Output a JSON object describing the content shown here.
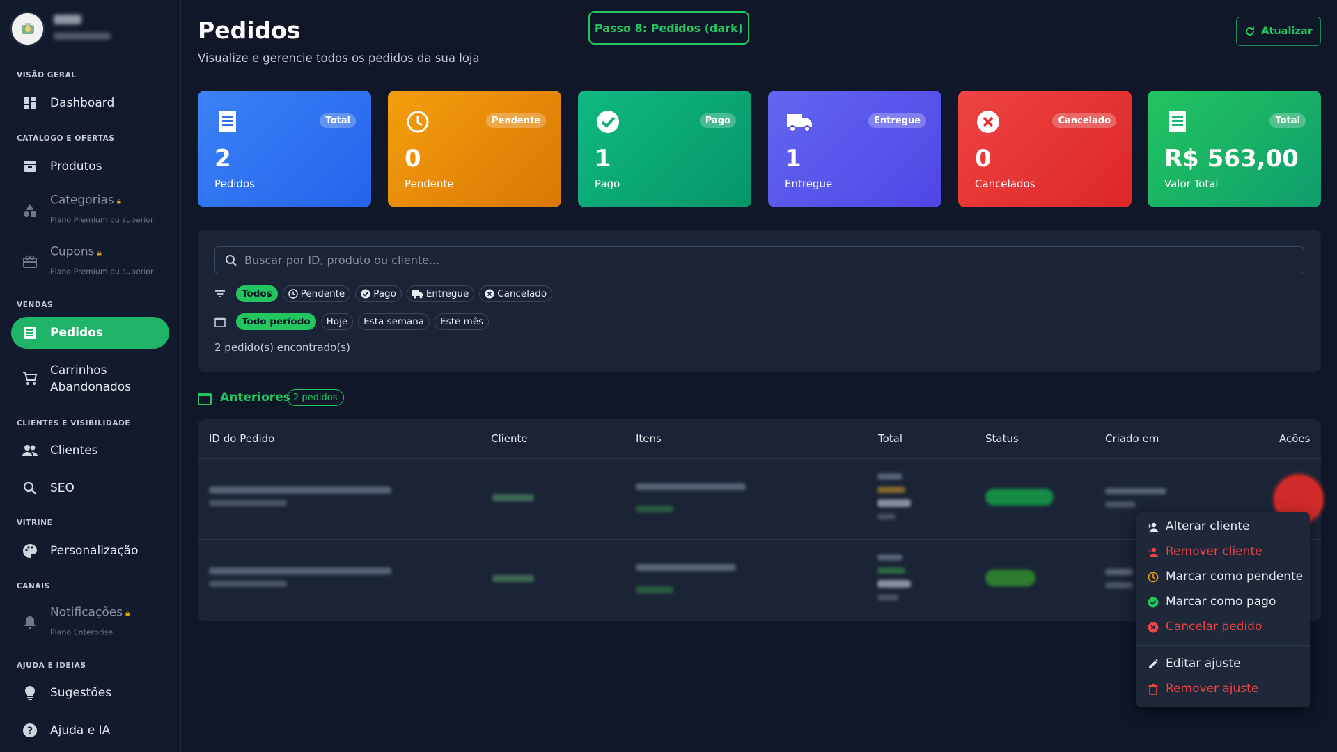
{
  "sidebar": {
    "sections": {
      "overview": "VISÃO GERAL",
      "catalog": "CATÁLOGO E OFERTAS",
      "sales": "VENDAS",
      "clients": "CLIENTES E VISIBILIDADE",
      "showcase": "VITRINE",
      "channels": "CANAIS",
      "help": "AJUDA E IDEIAS"
    },
    "items": {
      "dashboard": "Dashboard",
      "produtos": "Produtos",
      "categorias": "Categorias",
      "categorias_sub": "Plano Premium ou superior",
      "cupons": "Cupons",
      "cupons_sub": "Plano Premium ou superior",
      "pedidos": "Pedidos",
      "carrinhos_1": "Carrinhos",
      "carrinhos_2": "Abandonados",
      "clientes": "Clientes",
      "seo": "SEO",
      "personalizacao": "Personalização",
      "notificacoes": "Notificações",
      "notificacoes_sub": "Plano Enterprise",
      "sugestoes": "Sugestões",
      "ajuda": "Ajuda e IA"
    }
  },
  "header": {
    "title": "Pedidos",
    "subtitle": "Visualize e gerencie todos os pedidos da sua loja",
    "step_badge": "Passo 8: Pedidos (dark)",
    "refresh": "Atualizar"
  },
  "cards": [
    {
      "badge": "Total",
      "value": "2",
      "label": "Pedidos",
      "icon": "receipt-icon"
    },
    {
      "badge": "Pendente",
      "value": "0",
      "label": "Pendente",
      "icon": "clock-icon"
    },
    {
      "badge": "Pago",
      "value": "1",
      "label": "Pago",
      "icon": "check-circle-icon"
    },
    {
      "badge": "Entregue",
      "value": "1",
      "label": "Entregue",
      "icon": "truck-icon"
    },
    {
      "badge": "Cancelado",
      "value": "0",
      "label": "Cancelados",
      "icon": "x-circle-icon"
    },
    {
      "badge": "Total",
      "value": "R$ 563,00",
      "label": "Valor Total",
      "icon": "receipt-icon"
    }
  ],
  "colors": {
    "accent": "#22c55e",
    "card_total": "#2f6ff0",
    "card_pending": "#f09a10",
    "card_paid": "#10b07a",
    "card_delivered": "#5b4fe8",
    "card_canceled": "#e5323a",
    "card_value": "#1bb874"
  },
  "filters": {
    "search_placeholder": "Buscar por ID, produto ou cliente...",
    "status": [
      "Todos",
      "Pendente",
      "Pago",
      "Entregue",
      "Cancelado"
    ],
    "period": [
      "Todo período",
      "Hoje",
      "Esta semana",
      "Este mês"
    ],
    "found": "2 pedido(s) encontrado(s)"
  },
  "section": {
    "title": "Anteriores",
    "count": "2 pedidos"
  },
  "table": {
    "headers": [
      "ID do Pedido",
      "Cliente",
      "Itens",
      "Total",
      "Status",
      "Criado em",
      "Ações"
    ]
  },
  "menu": {
    "items": [
      "Alterar cliente",
      "Remover cliente",
      "Marcar como pendente",
      "Marcar como pago",
      "Cancelar pedido",
      "Editar ajuste",
      "Remover ajuste"
    ]
  }
}
